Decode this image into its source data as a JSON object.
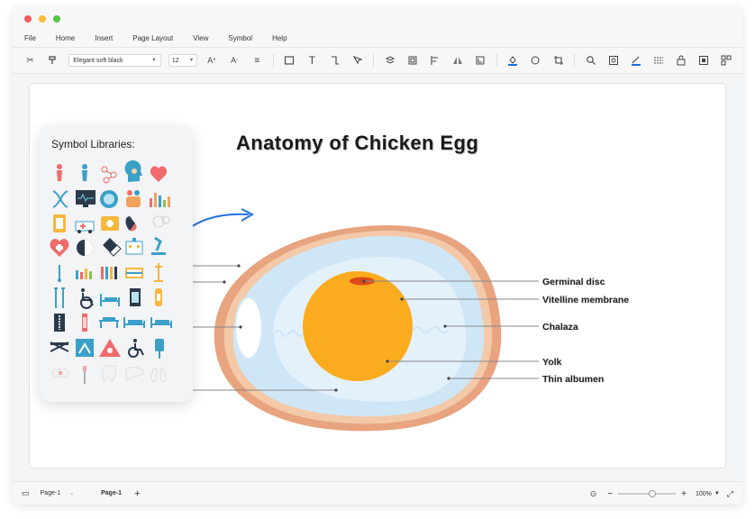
{
  "window": {
    "controls": {
      "close_color": "#f15c5a",
      "minimize_color": "#f8be3b",
      "maximize_color": "#52c844"
    }
  },
  "menu": [
    "File",
    "Home",
    "Insert",
    "Page Layout",
    "View",
    "Symbol",
    "Help"
  ],
  "toolbar": {
    "font_family": "Elegant soft black",
    "font_size": "12",
    "icons": [
      "scissors-icon",
      "format-painter-icon",
      "increase-font-icon",
      "decrease-font-icon",
      "align-icon",
      "rectangle-icon",
      "text-icon",
      "connector-icon",
      "pointer-icon",
      "layers-icon",
      "group-icon",
      "align-left-icon",
      "flip-icon",
      "frame-icon",
      "fill-icon",
      "shape-style-icon",
      "crop-icon",
      "search-icon",
      "preview-icon",
      "line-color-icon",
      "line-style-icon",
      "lock-icon",
      "fit-icon",
      "more-icon"
    ]
  },
  "symbol_panel": {
    "title": "Symbol Libraries:"
  },
  "diagram": {
    "title": "Anatomy of Chicken Egg",
    "labels": [
      "Germinal disc",
      "Vitelline membrane",
      "Chalaza",
      "Yolk",
      "Thin albumen"
    ],
    "colors": {
      "shell": "#e8a37f",
      "membrane": "#f3c9a8",
      "outer_albumen": "#cfe6f7",
      "inner_albumen": "#e3f1fb",
      "yolk": "#fbab1e",
      "germinal_disc": "#e04a1a",
      "air_cell": "#ffffff",
      "arrow": "#1f6fe0"
    }
  },
  "status": {
    "page_selector": "Page-1",
    "active_page": "Page-1",
    "zoom": "100%"
  }
}
